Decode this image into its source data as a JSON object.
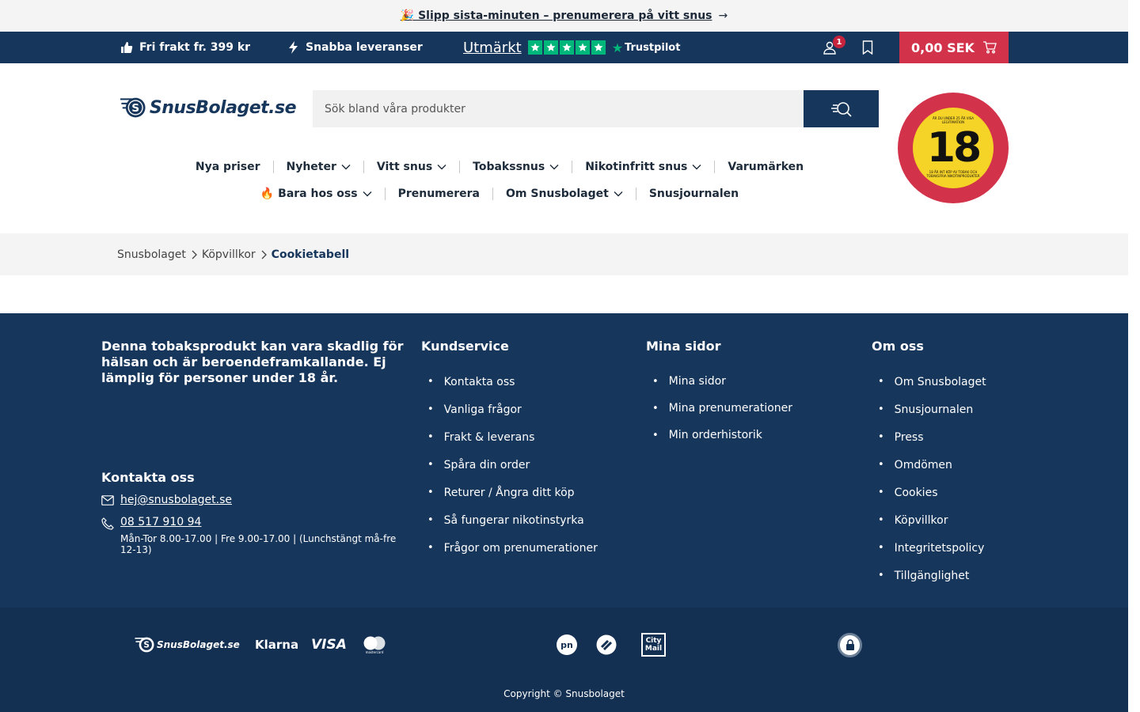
{
  "promo": {
    "text": "🎉 Slipp sista-minuten – prenumerera på vitt snus",
    "arrow": "→"
  },
  "usp": {
    "free_shipping": "Fri frakt fr. 399 kr",
    "fast_delivery": "Snabba leveranser",
    "trustpilot_rating": "Utmärkt",
    "trustpilot_brand": "Trustpilot",
    "trustpilot_stars": 5
  },
  "account": {
    "badge_count": "1"
  },
  "cart": {
    "total": "0,00 SEK"
  },
  "header": {
    "logo_text": "SnusBolaget.se",
    "search_placeholder": "Sök bland våra produkter"
  },
  "age_badge": {
    "number": "18",
    "top_text": "ÄR DU UNDER 25 ÅR VISA LEGITIMATION",
    "bottom_text": "18 ÅR INT KÖP AV TOBAK OCH TOBAKSFRIA NIKOTINPRODUKTER"
  },
  "nav": {
    "row1": [
      {
        "label": "Nya priser",
        "dropdown": false
      },
      {
        "label": "Nyheter",
        "dropdown": true
      },
      {
        "label": "Vitt snus",
        "dropdown": true
      },
      {
        "label": "Tobakssnus",
        "dropdown": true
      },
      {
        "label": "Nikotinfritt snus",
        "dropdown": true
      },
      {
        "label": "Varumärken",
        "dropdown": false
      }
    ],
    "row2": [
      {
        "label": "🔥 Bara hos oss",
        "dropdown": true
      },
      {
        "label": "Prenumerera",
        "dropdown": false
      },
      {
        "label": "Om Snusbolaget",
        "dropdown": true
      },
      {
        "label": "Snusjournalen",
        "dropdown": false
      }
    ]
  },
  "breadcrumb": {
    "items": [
      "Snusbolaget",
      "Köpvillkor"
    ],
    "current": "Cookietabell"
  },
  "footer": {
    "warning": "Denna tobaksprodukt kan vara skadlig för hälsan och är beroendeframkallande. Ej lämplig för personer under 18 år.",
    "contact": {
      "heading": "Kontakta oss",
      "email": "hej@snusbolaget.se",
      "phone": "08 517 910 94",
      "hours": "Mån-Tor 8.00-17.00 | Fre 9.00-17.00 | (Lunchstängt må-fre 12-13)"
    },
    "kundservice": {
      "heading": "Kundservice",
      "links": [
        "Kontakta oss",
        "Vanliga frågor",
        "Frakt & leverans",
        "Spåra din order",
        "Returer / Ångra ditt köp",
        "Så fungerar nikotinstyrka",
        "Frågor om prenumerationer"
      ]
    },
    "mina_sidor": {
      "heading": "Mina sidor",
      "links": [
        "Mina sidor",
        "Mina prenumerationer",
        "Min orderhistorik"
      ]
    },
    "om_oss": {
      "heading": "Om oss",
      "links": [
        "Om Snusbolaget",
        "Snusjournalen",
        "Press",
        "Omdömen",
        "Cookies",
        "Köpvillkor",
        "Integritetspolicy",
        "Tillgänglighet"
      ]
    },
    "logos": {
      "brand": "SnusBolaget.se",
      "klarna": "Klarna",
      "visa": "VISA",
      "mastercard": "mastercard",
      "postnord": "pn",
      "citymail_line1": "City",
      "citymail_line2": "Mail",
      "trygg": "TRYGG HANDEL"
    },
    "copyright": "Copyright © Snusbolaget"
  },
  "colors": {
    "navy": "#17365c",
    "red": "#d3334a",
    "yellow": "#f6d327",
    "trustpilot_green": "#00b67a"
  }
}
